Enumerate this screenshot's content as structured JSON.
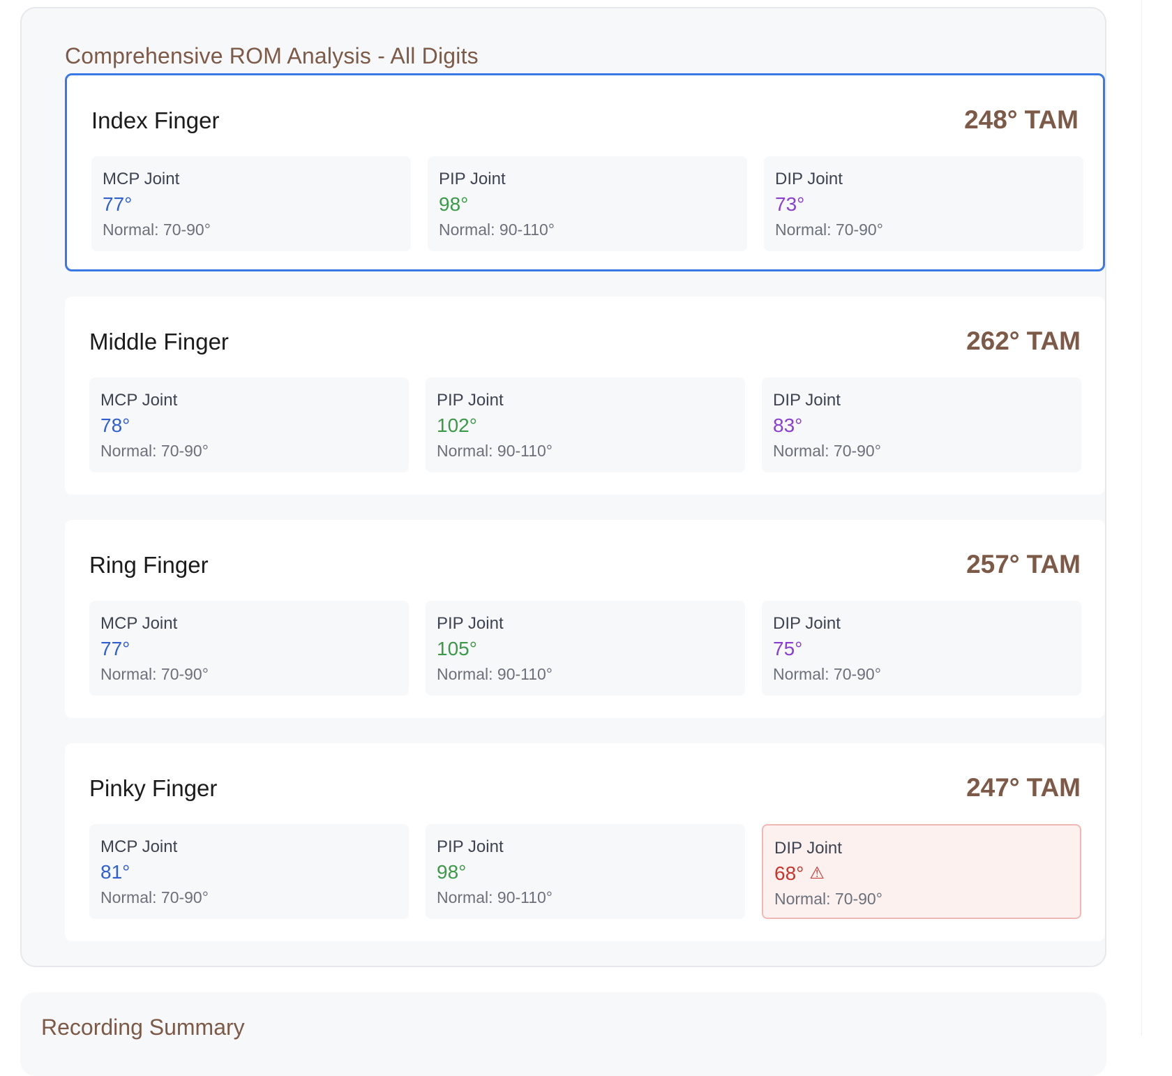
{
  "rom_panel": {
    "title": "Comprehensive ROM Analysis - All Digits",
    "fingers": [
      {
        "name": "Index Finger",
        "tam_value": "248°",
        "tam_unit": "TAM",
        "selected": true,
        "joints": [
          {
            "label": "MCP Joint",
            "value": "77°",
            "normal": "Normal: 70-90°"
          },
          {
            "label": "PIP Joint",
            "value": "98°",
            "normal": "Normal: 90-110°"
          },
          {
            "label": "DIP Joint",
            "value": "73°",
            "normal": "Normal: 70-90°"
          }
        ]
      },
      {
        "name": "Middle Finger",
        "tam_value": "262°",
        "tam_unit": "TAM",
        "selected": false,
        "joints": [
          {
            "label": "MCP Joint",
            "value": "78°",
            "normal": "Normal: 70-90°"
          },
          {
            "label": "PIP Joint",
            "value": "102°",
            "normal": "Normal: 90-110°"
          },
          {
            "label": "DIP Joint",
            "value": "83°",
            "normal": "Normal: 70-90°"
          }
        ]
      },
      {
        "name": "Ring Finger",
        "tam_value": "257°",
        "tam_unit": "TAM",
        "selected": false,
        "joints": [
          {
            "label": "MCP Joint",
            "value": "77°",
            "normal": "Normal: 70-90°"
          },
          {
            "label": "PIP Joint",
            "value": "105°",
            "normal": "Normal: 90-110°"
          },
          {
            "label": "DIP Joint",
            "value": "75°",
            "normal": "Normal: 70-90°"
          }
        ]
      },
      {
        "name": "Pinky Finger",
        "tam_value": "247°",
        "tam_unit": "TAM",
        "selected": false,
        "joints": [
          {
            "label": "MCP Joint",
            "value": "81°",
            "normal": "Normal: 70-90°"
          },
          {
            "label": "PIP Joint",
            "value": "98°",
            "normal": "Normal: 90-110°"
          },
          {
            "label": "DIP Joint",
            "value": "68°",
            "normal": "Normal: 70-90°",
            "warning": true,
            "warning_icon": "⚠"
          }
        ]
      }
    ]
  },
  "summary_panel": {
    "title": "Recording Summary"
  },
  "colors": {
    "mcp": "#3060d0",
    "pip": "#3b9a47",
    "dip": "#8a3fcf",
    "warning": "#c8352d",
    "selected_border": "#3b78e7",
    "heading_brown": "#7d5a48"
  }
}
